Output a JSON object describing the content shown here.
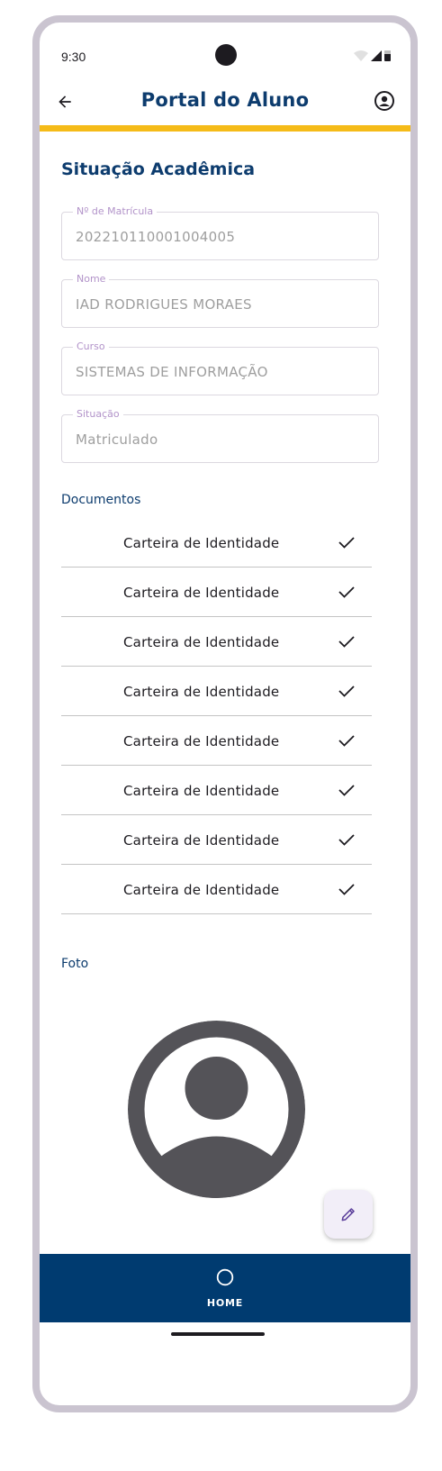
{
  "status_bar": {
    "time": "9:30"
  },
  "app_bar": {
    "title": "Portal do Aluno",
    "back_icon": "arrow-back-icon",
    "account_icon": "account-circle-icon"
  },
  "colors": {
    "primary": "#0d3c6e",
    "accent": "#f5bb18",
    "nav_bg": "#003b70",
    "label": "#b293c9"
  },
  "section_title": "Situação Acadêmica",
  "fields": [
    {
      "label": "Nº de Matrícula",
      "value": "202210110001004005"
    },
    {
      "label": "Nome",
      "value": "IAD RODRIGUES MORAES"
    },
    {
      "label": "Curso",
      "value": "SISTEMAS DE INFORMAÇÃO"
    },
    {
      "label": "Situação",
      "value": "Matriculado"
    }
  ],
  "documents": {
    "heading": "Documentos",
    "items": [
      {
        "label": "Carteira de Identidade"
      },
      {
        "label": "Carteira de Identidade"
      },
      {
        "label": "Carteira de Identidade"
      },
      {
        "label": "Carteira de Identidade"
      },
      {
        "label": "Carteira de Identidade"
      },
      {
        "label": "Carteira de Identidade"
      },
      {
        "label": "Carteira de Identidade"
      },
      {
        "label": "Carteira de Identidade"
      }
    ]
  },
  "photo": {
    "heading": "Foto",
    "icon": "person-placeholder-icon"
  },
  "fab": {
    "icon": "edit-pencil-icon"
  },
  "bottom_nav": {
    "home_label": "HOME",
    "home_icon": "home-circle-icon"
  }
}
